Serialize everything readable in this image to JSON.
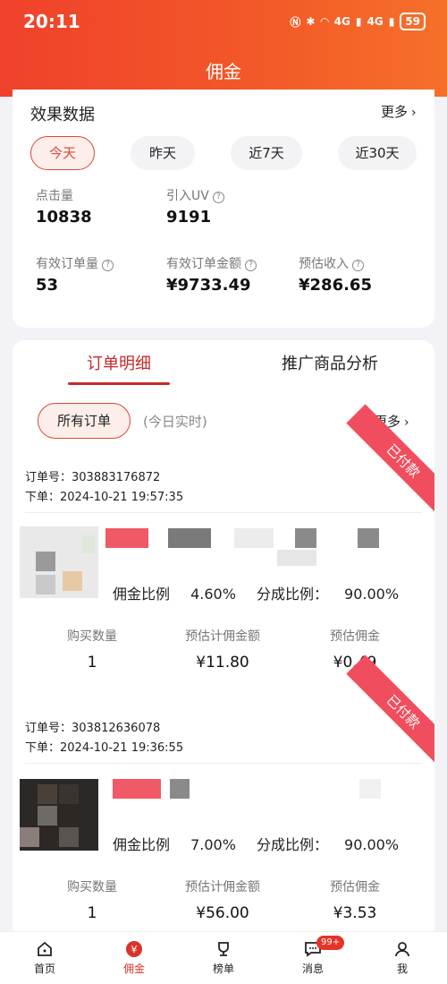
{
  "status_bar": {
    "time": "20:11",
    "network": "4G",
    "network2": "4G",
    "battery": "59"
  },
  "nav": {
    "title": "佣金"
  },
  "effect": {
    "title": "效果数据",
    "more": "更多",
    "ranges": [
      "今天",
      "昨天",
      "近7天",
      "近30天"
    ],
    "active_range": "今天",
    "stats": [
      {
        "label": "点击量",
        "value": "10838",
        "help": false
      },
      {
        "label": "引入UV",
        "value": "9191",
        "help": true
      },
      {
        "label": "有效订单量",
        "value": "53",
        "help": true
      },
      {
        "label": "有效订单金额",
        "value": "¥9733.49",
        "help": true
      },
      {
        "label": "预估收入",
        "value": "¥286.65",
        "help": true
      }
    ]
  },
  "orders_section": {
    "tabs": [
      "订单明细",
      "推广商品分析"
    ],
    "active_tab": "订单明细",
    "filter": "所有订单",
    "filter_hint": "(今日实时)",
    "more": "更多",
    "metric_labels": [
      "购买数量",
      "预估计佣金额",
      "预估佣金"
    ],
    "orders": [
      {
        "order_no_label": "订单号：",
        "order_no": "303883176872",
        "time_label": "下单：",
        "time": "2024-10-21 19:57:35",
        "status": "已付款",
        "commission_rate_label": "佣金比例",
        "commission_rate": "4.60%",
        "share_rate_label": "分成比例：",
        "share_rate": "90.00%",
        "quantity": "1",
        "commission_base": "¥11.80",
        "commission": "¥0.49"
      },
      {
        "order_no_label": "订单号：",
        "order_no": "303812636078",
        "time_label": "下单：",
        "time": "2024-10-21 19:36:55",
        "status": "已付款",
        "commission_rate_label": "佣金比例",
        "commission_rate": "7.00%",
        "share_rate_label": "分成比例：",
        "share_rate": "90.00%",
        "quantity": "1",
        "commission_base": "¥56.00",
        "commission": "¥3.53"
      }
    ]
  },
  "tabbar": [
    {
      "label": "首页",
      "icon": "home-icon"
    },
    {
      "label": "佣金",
      "icon": "yen-icon"
    },
    {
      "label": "榜单",
      "icon": "trophy-icon"
    },
    {
      "label": "消息",
      "icon": "message-icon",
      "badge": "99+"
    },
    {
      "label": "我",
      "icon": "user-icon"
    }
  ],
  "colors": {
    "header_start": "#f0412b",
    "header_end": "#f6702a",
    "accent": "#c8292b",
    "ribbon": "#f04e5e"
  }
}
